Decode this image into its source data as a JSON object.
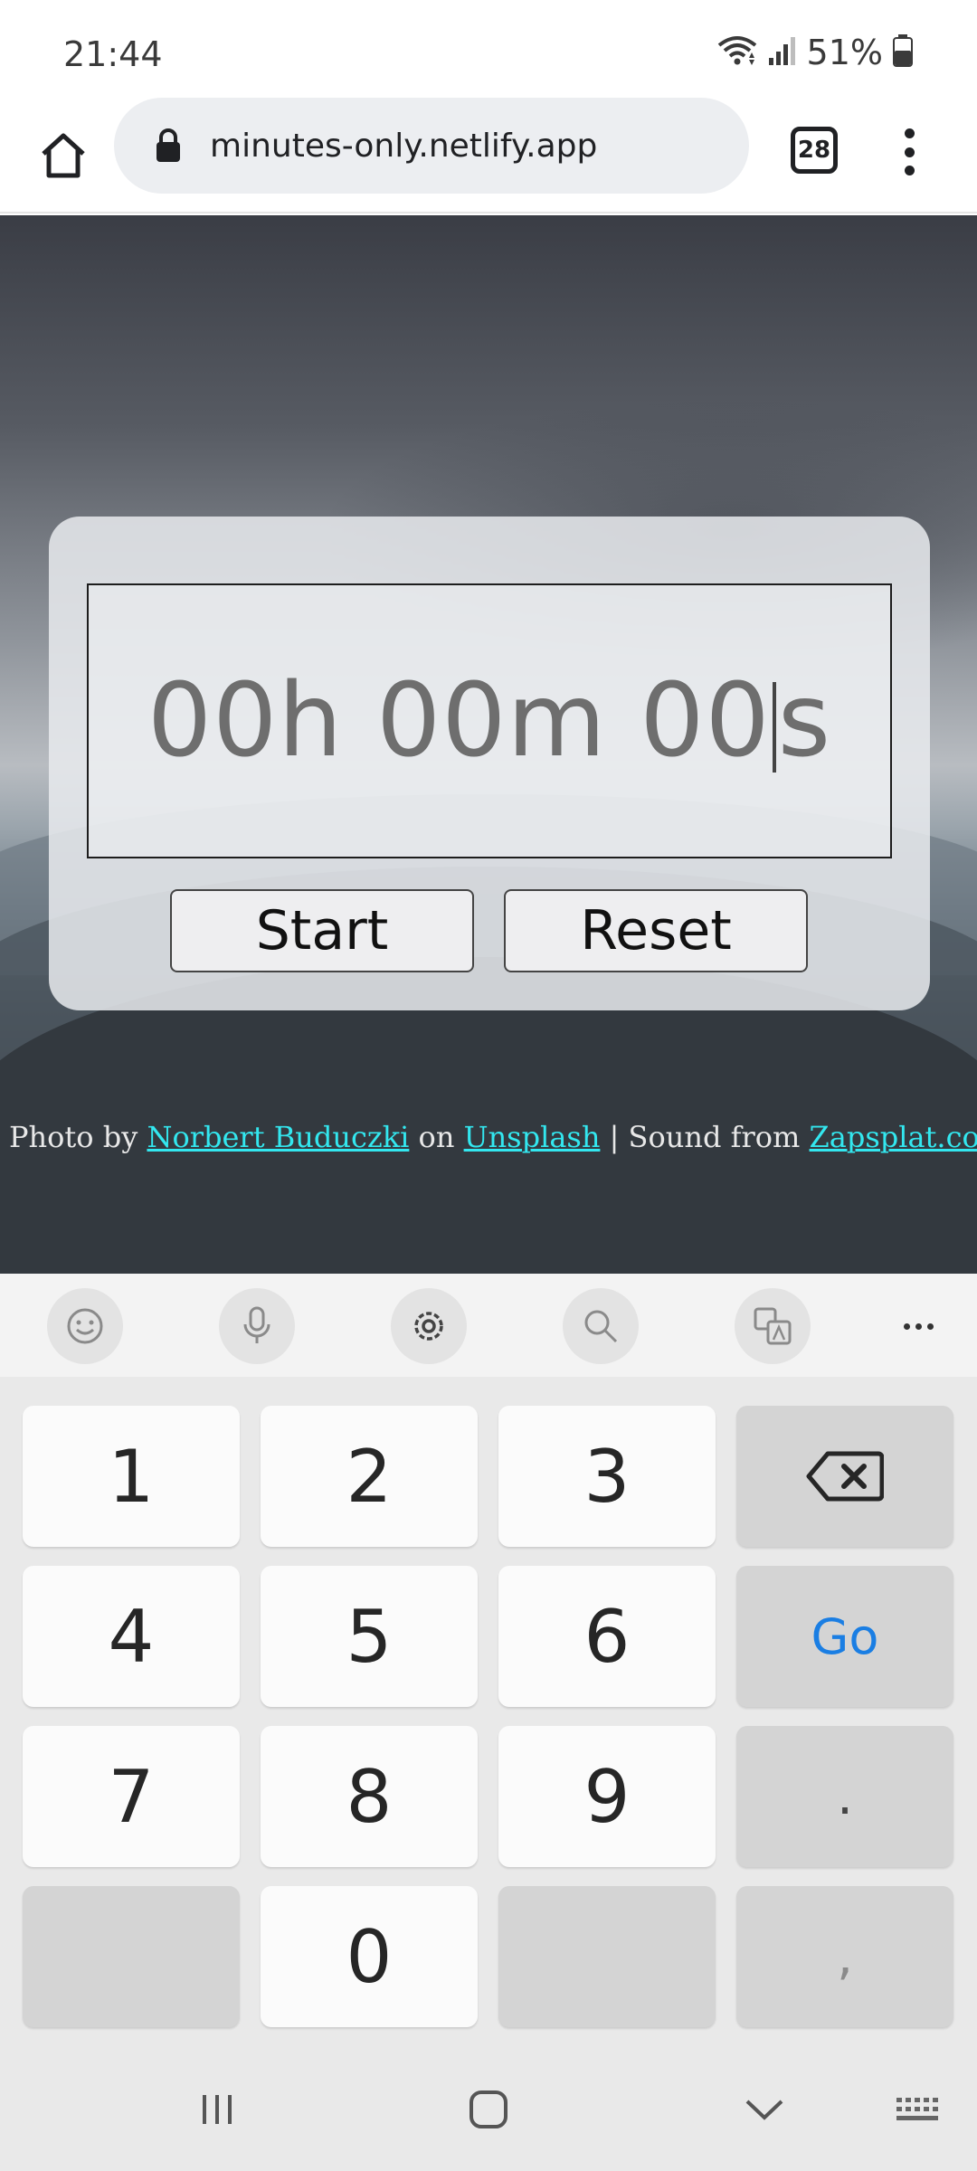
{
  "status_bar": {
    "time": "21:44",
    "battery_percent": "51%",
    "battery_level": 0.51,
    "icons": [
      "wifi-icon",
      "signal-icon",
      "battery-icon"
    ]
  },
  "browser": {
    "url": "minutes-only.netlify.app",
    "tab_count": "28",
    "icons": [
      "home-icon",
      "lock-icon",
      "tabs-icon",
      "more-menu-icon"
    ]
  },
  "timer": {
    "hours": "00h",
    "minutes": "00m",
    "seconds_before_cursor": "00",
    "seconds_after_cursor": "s",
    "start_label": "Start",
    "reset_label": "Reset"
  },
  "credits": {
    "prefix": "Photo by",
    "photographer": "Norbert Buduczki",
    "on": "on",
    "site": "Unsplash",
    "separator": "| Sound from",
    "sound_site": "Zapsplat.com"
  },
  "keyboard": {
    "toolbar_icons": [
      "emoji-icon",
      "microphone-icon",
      "settings-icon",
      "search-icon",
      "translate-icon",
      "more-icon"
    ],
    "rows": [
      [
        "1",
        "2",
        "3",
        "backspace"
      ],
      [
        "4",
        "5",
        "6",
        "Go"
      ],
      [
        "7",
        "8",
        "9",
        "."
      ],
      [
        "",
        "0",
        "",
        ","
      ]
    ],
    "go_label": "Go",
    "period": ".",
    "comma": ","
  },
  "colors": {
    "link": "#33e7ef",
    "go_key": "#1a7ee3",
    "card_bg": "#e8eaed"
  }
}
